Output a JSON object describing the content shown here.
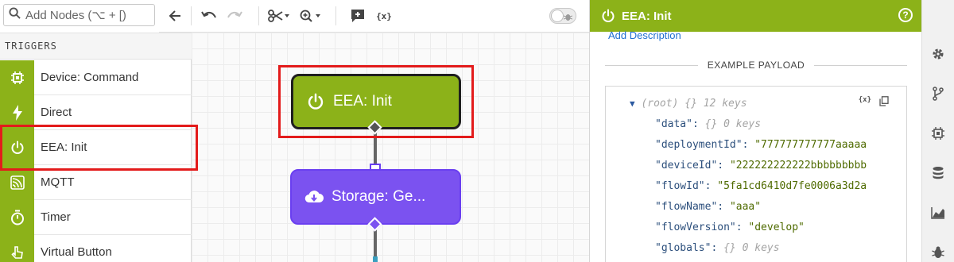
{
  "search": {
    "placeholder": "Add Nodes (⌥ + [)"
  },
  "sidebar": {
    "section_title": "TRIGGERS",
    "items": [
      {
        "label": "Device: Command",
        "icon": "chip-icon"
      },
      {
        "label": "Direct",
        "icon": "bolt-icon"
      },
      {
        "label": "EEA: Init",
        "icon": "power-icon",
        "selected": true
      },
      {
        "label": "MQTT",
        "icon": "mqtt-icon"
      },
      {
        "label": "Timer",
        "icon": "stopwatch-icon"
      },
      {
        "label": "Virtual Button",
        "icon": "cursor-icon"
      }
    ]
  },
  "toolbar": {
    "buttons": [
      "back-arrow-icon",
      "undo-icon",
      "redo-icon",
      "scissors-icon",
      "zoom-icon",
      "add-comment-icon",
      "variables-icon"
    ],
    "variables_label": "{x}",
    "toggle_on": false
  },
  "canvas": {
    "nodes": [
      {
        "label": "EEA: Init",
        "icon": "power-icon",
        "color": "#8cb219"
      },
      {
        "label": "Storage: Ge...",
        "icon": "cloud-download-icon",
        "color": "#7b52f0"
      }
    ]
  },
  "panel": {
    "title": "EEA: Init",
    "help_label": "?",
    "add_description": "Add Description",
    "example_payload_title": "EXAMPLE PAYLOAD",
    "payload": {
      "root_label": "(root)",
      "root_braces": "{}",
      "root_count": "12 keys",
      "rows": [
        {
          "key": "\"data\"",
          "value": "{}",
          "note": "0 keys",
          "kind": "obj"
        },
        {
          "key": "\"deploymentId\"",
          "value": "\"777777777777aaaaa",
          "kind": "str"
        },
        {
          "key": "\"deviceId\"",
          "value": "\"222222222222bbbbbbbbb",
          "kind": "str"
        },
        {
          "key": "\"flowId\"",
          "value": "\"5fa1cd6410d7fe0006a3d2a",
          "kind": "str"
        },
        {
          "key": "\"flowName\"",
          "value": "\"aaa\"",
          "kind": "str"
        },
        {
          "key": "\"flowVersion\"",
          "value": "\"develop\"",
          "kind": "str"
        },
        {
          "key": "\"globals\"",
          "value": "{}",
          "note": "0 keys",
          "kind": "obj"
        }
      ]
    }
  },
  "rail": {
    "icons": [
      "gear-icon",
      "branch-icon",
      "chip-icon",
      "database-icon",
      "chart-icon",
      "bug-icon"
    ]
  },
  "colors": {
    "accent_green": "#8cb219",
    "node_purple": "#7b52f0",
    "highlight_red": "#e31b1b",
    "link_blue": "#1f6fd1"
  }
}
